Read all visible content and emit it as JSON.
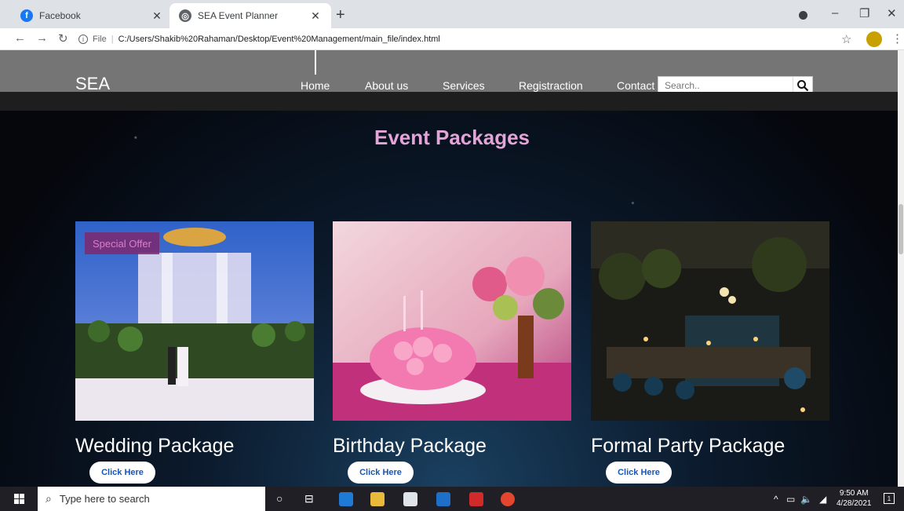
{
  "browser": {
    "tabs": [
      {
        "label": "Facebook",
        "icon": "facebook-icon"
      },
      {
        "label": "SEA Event Planner",
        "icon": "globe-icon"
      }
    ],
    "url_scheme": "File",
    "url": "C:/Users/Shakib%20Rahaman/Desktop/Event%20Management/main_file/index.html"
  },
  "site": {
    "logo": "SEA",
    "nav": [
      "Home",
      "About us",
      "Services",
      "Registraction",
      "Contact"
    ],
    "search_placeholder": "Search..",
    "section_title": "Event Packages",
    "offer_badge": "Special Offer",
    "packages": [
      {
        "title": "Wedding Package",
        "button": "Click Here"
      },
      {
        "title": "Birthday Package",
        "button": "Click Here"
      },
      {
        "title": "Formal Party Package",
        "button": "Click Here"
      }
    ]
  },
  "taskbar": {
    "search_placeholder": "Type here to search",
    "time": "9:50 AM",
    "date": "4/28/2021",
    "notification_count": "1"
  }
}
